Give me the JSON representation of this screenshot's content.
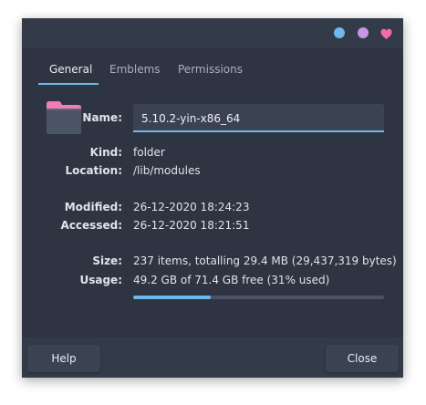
{
  "window": {
    "controls": [
      {
        "name": "minimize",
        "icon": "circle-icon",
        "color": "#6fb8eb"
      },
      {
        "name": "maximize",
        "icon": "circle-icon",
        "color": "#c895e6"
      },
      {
        "name": "close",
        "icon": "heart-icon",
        "color": "#f06cab"
      }
    ]
  },
  "tabs": [
    {
      "label": "General",
      "active": true
    },
    {
      "label": "Emblems",
      "active": false
    },
    {
      "label": "Permissions",
      "active": false
    }
  ],
  "general": {
    "icon": "folder-icon",
    "name_label": "Name:",
    "name_value": "5.10.2-yin-x86_64",
    "kind_label": "Kind:",
    "kind_value": "folder",
    "location_label": "Location:",
    "location_value": "/lib/modules",
    "modified_label": "Modified:",
    "modified_value": "26-12-2020 18:24:23",
    "accessed_label": "Accessed:",
    "accessed_value": "26-12-2020 18:21:51",
    "size_label": "Size:",
    "size_value": "237 items, totalling 29.4 MB (29,437,319 bytes)",
    "usage_label": "Usage:",
    "usage_value": "49.2 GB of 71.4 GB free (31% used)",
    "usage_fraction": 0.31
  },
  "buttons": {
    "help": "Help",
    "close": "Close"
  },
  "colors": {
    "accent": "#6fb8eb",
    "folder_tab": "#f17db4"
  }
}
